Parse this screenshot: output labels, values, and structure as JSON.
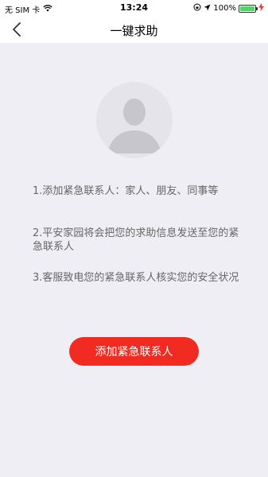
{
  "status_bar": {
    "carrier": "无 SIM 卡",
    "time": "13:24",
    "battery": "100%",
    "battery_level": 1.0
  },
  "nav": {
    "title": "一键求助",
    "back_icon": "chevron-left-icon"
  },
  "avatar": {
    "icon": "user-silhouette-icon"
  },
  "info": [
    "1.添加紧急联系人：家人、朋友、同事等",
    "2.平安家园将会把您的求助信息发送至您的紧急联系人",
    "3.客服致电您的紧急联系人核实您的安全状况"
  ],
  "action": {
    "add_contact_label": "添加紧急联系人"
  },
  "colors": {
    "accent": "#f22b22",
    "background": "#efeef4",
    "text_secondary": "#666666",
    "battery": "#4cd964"
  }
}
